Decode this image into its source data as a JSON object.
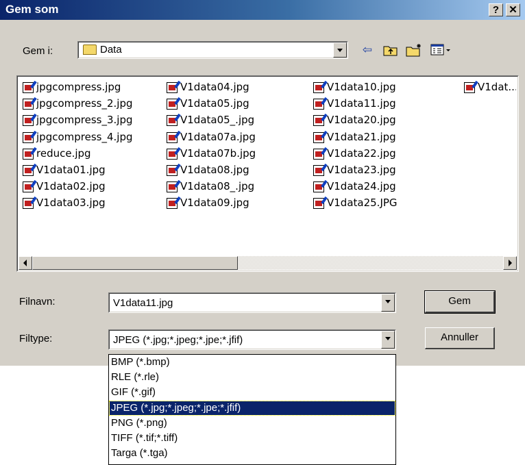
{
  "window": {
    "title": "Gem som",
    "help_label": "?",
    "close_label": "✕"
  },
  "toolbar": {
    "save_in_label": "Gem i:",
    "folder_name": "Data",
    "icons": [
      "folder-icon",
      "back-arrow-icon",
      "up-folder-icon",
      "new-folder-icon",
      "view-menu-icon"
    ]
  },
  "files": [
    "jpgcompress.jpg",
    "jpgcompress_2.jpg",
    "jpgcompress_3.jpg",
    "jpgcompress_4.jpg",
    "reduce.jpg",
    "V1data01.jpg",
    "V1data02.jpg",
    "V1data03.jpg",
    "V1data04.jpg",
    "V1data05.jpg",
    "V1data05_.jpg",
    "V1data07a.jpg",
    "V1data07b.jpg",
    "V1data08.jpg",
    "V1data08_.jpg",
    "V1data09.jpg",
    "V1data10.jpg",
    "V1data11.jpg",
    "V1data20.jpg",
    "V1data21.jpg",
    "V1data22.jpg",
    "V1data23.jpg",
    "V1data24.jpg",
    "V1data25.JPG",
    "V1dat..."
  ],
  "form": {
    "filename_label": "Filnavn:",
    "filename_value": "V1data11.jpg",
    "filetype_label": "Filtype:",
    "filetype_value": "JPEG (*.jpg;*.jpeg;*.jpe;*.jfif)",
    "save_button": "Gem",
    "cancel_button": "Annuller"
  },
  "filetype_options": [
    {
      "label": "BMP (*.bmp)",
      "selected": false
    },
    {
      "label": "RLE (*.rle)",
      "selected": false
    },
    {
      "label": "GIF (*.gif)",
      "selected": false
    },
    {
      "label": "JPEG (*.jpg;*.jpeg;*.jpe;*.jfif)",
      "selected": true
    },
    {
      "label": "PNG (*.png)",
      "selected": false
    },
    {
      "label": "TIFF (*.tif;*.tiff)",
      "selected": false
    },
    {
      "label": "Targa (*.tga)",
      "selected": false
    }
  ],
  "colors": {
    "title_start": "#0a246a",
    "title_end": "#a6caf0",
    "face": "#d4d0c8",
    "selection": "#0a246a"
  }
}
